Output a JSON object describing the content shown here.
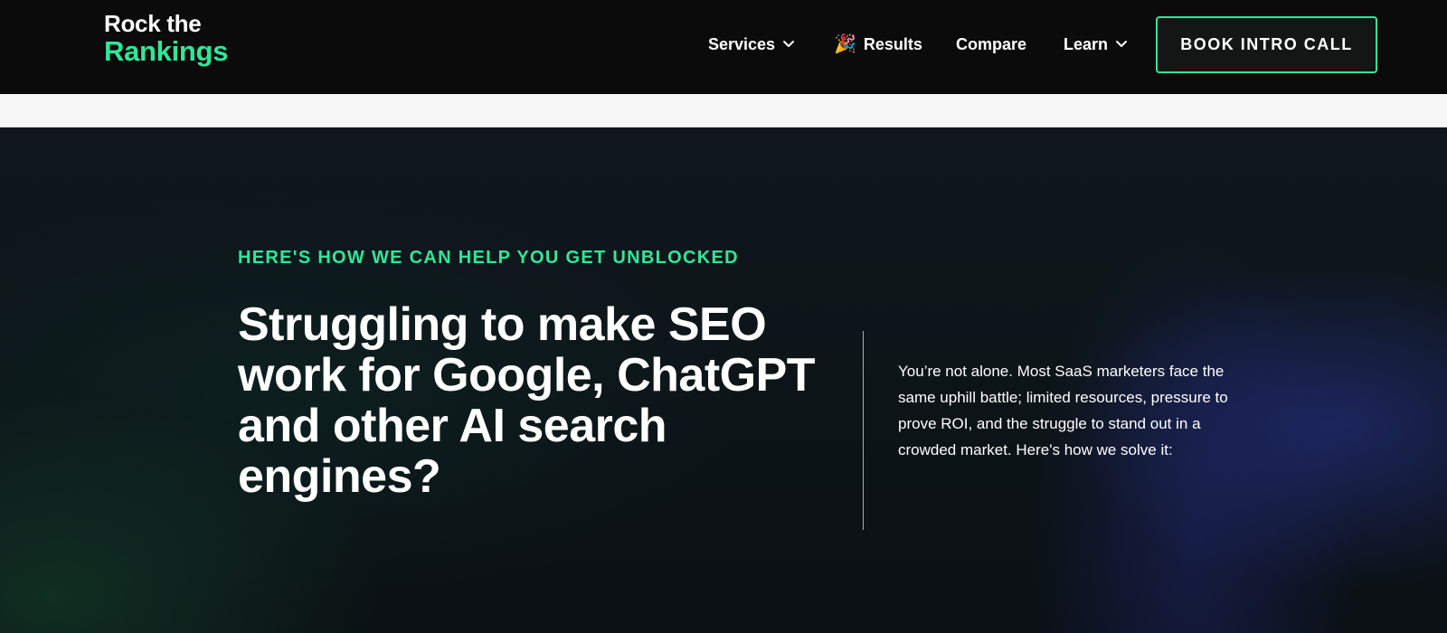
{
  "nav": {
    "logo_line1": "Rock the",
    "logo_line2": "Rankings",
    "items": [
      {
        "label": "Services",
        "icon": "chevron-down-icon"
      },
      {
        "label": "Results",
        "icon": "party-popper-icon",
        "emoji": "🎉"
      },
      {
        "label": "Compare"
      },
      {
        "label": "Learn",
        "icon": "chevron-down-icon"
      }
    ],
    "cta_label": "BOOK INTRO CALL"
  },
  "hero": {
    "eyebrow": "HERE'S HOW WE CAN HELP YOU GET UNBLOCKED",
    "headline": "Struggling to make SEO work for Google, ChatGPT and other AI search engines?",
    "body": "You’re not alone. Most SaaS marketers face the same uphill battle; limited resources, pressure to prove ROI, and the struggle to stand out in a crowded market. Here's how we solve it:"
  },
  "colors": {
    "accent": "#2ee89a",
    "nav_bg": "#0c0b0c",
    "hero_bg": "#0d1519"
  }
}
